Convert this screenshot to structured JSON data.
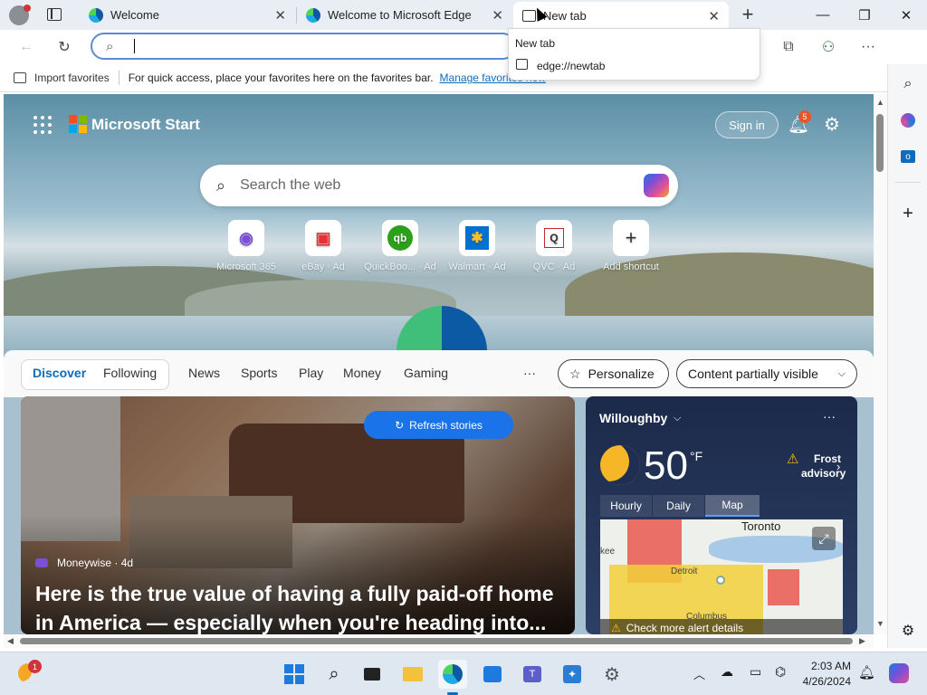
{
  "tabs": [
    {
      "label": "Welcome"
    },
    {
      "label": "Welcome to Microsoft Edge"
    },
    {
      "label": "New tab"
    }
  ],
  "address": {
    "value": ""
  },
  "favorites": {
    "import_label": "Import favorites",
    "message": "For quick access, place your favorites here on the favorites bar.",
    "manage_link": "Manage favorites now"
  },
  "popup": {
    "title": "New tab",
    "url": "edge://newtab"
  },
  "start": {
    "brand": "Microsoft Start",
    "sign_in": "Sign in",
    "notification_count": "5",
    "search_placeholder": "Search the web"
  },
  "shortcuts": [
    {
      "label": "Microsoft 365",
      "ad": ""
    },
    {
      "label": "eBay",
      "ad": "Ad"
    },
    {
      "label": "QuickBoo...",
      "ad": "Ad"
    },
    {
      "label": "Walmart",
      "ad": "Ad"
    },
    {
      "label": "QVC",
      "ad": "Ad"
    },
    {
      "label": "Add shortcut",
      "ad": ""
    }
  ],
  "feed": {
    "tabs": [
      "Discover",
      "Following",
      "News",
      "Sports",
      "Play",
      "Money",
      "Gaming"
    ],
    "more": "···",
    "personalize": "Personalize",
    "content_visibility": "Content partially visible"
  },
  "story": {
    "refresh": "Refresh stories",
    "source": "Moneywise · 4d",
    "headline": "Here is the true value of having a fully paid-off home in America — especially when you're heading into..."
  },
  "weather": {
    "location": "Willoughby",
    "temperature": "50",
    "unit": "°F",
    "alert": "Frost advisory",
    "tabs": [
      "Hourly",
      "Daily",
      "Map"
    ],
    "map_city_1": "Toronto",
    "map_city_2": "Detroit",
    "map_city_3": "Columbus",
    "map_label_side": "kee",
    "alert_details": "Check more alert details"
  },
  "taskbar": {
    "time": "2:03 AM",
    "date": "4/26/2024",
    "badge": "1"
  },
  "colors": {
    "accent": "#0f6cbd",
    "refresh_button": "#1a73e8"
  }
}
